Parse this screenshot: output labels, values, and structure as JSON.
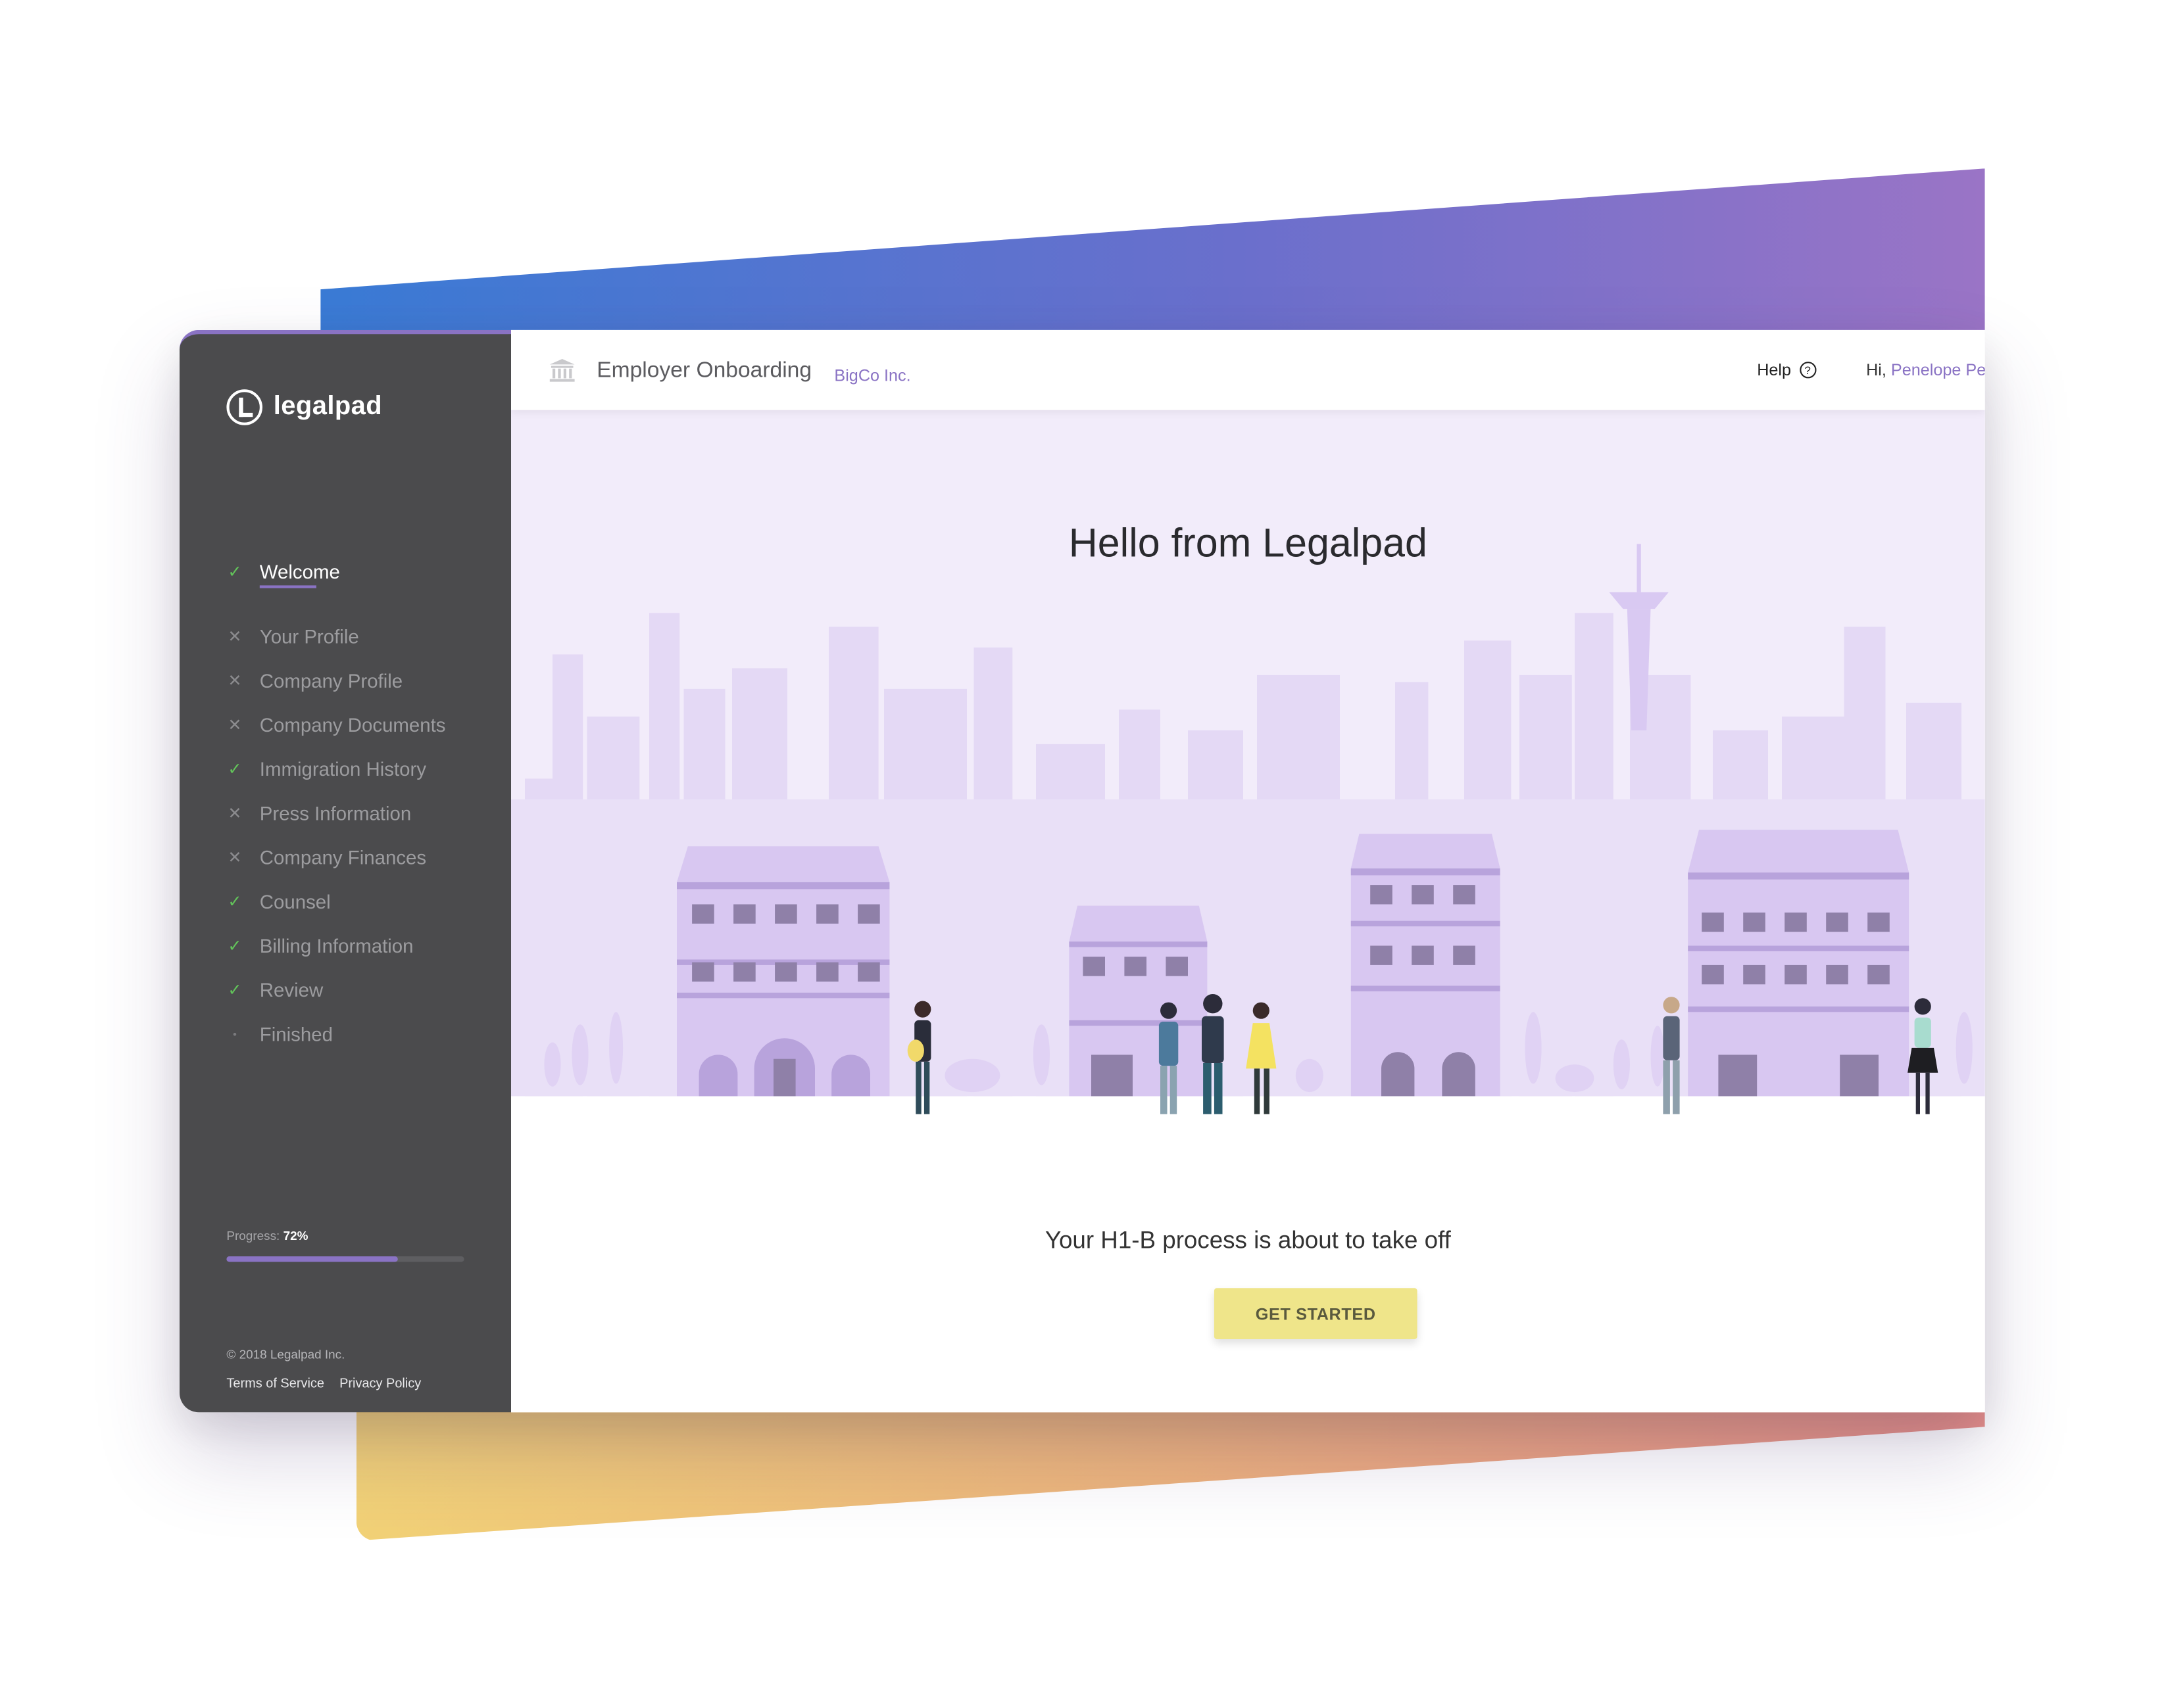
{
  "brand": {
    "name": "legalpad"
  },
  "header": {
    "title": "Employer Onboarding",
    "company": "BigCo Inc.",
    "help_label": "Help",
    "greeting_prefix": "Hi,",
    "user_name": "Penelope Pe"
  },
  "sidebar": {
    "steps": [
      {
        "label": "Welcome",
        "status": "done",
        "active": true
      },
      {
        "label": "Your Profile",
        "status": "incomplete"
      },
      {
        "label": "Company Profile",
        "status": "incomplete"
      },
      {
        "label": "Company Documents",
        "status": "incomplete"
      },
      {
        "label": "Immigration History",
        "status": "done"
      },
      {
        "label": "Press Information",
        "status": "incomplete"
      },
      {
        "label": "Company Finances",
        "status": "incomplete"
      },
      {
        "label": "Counsel",
        "status": "done"
      },
      {
        "label": "Billing Information",
        "status": "done"
      },
      {
        "label": "Review",
        "status": "done"
      },
      {
        "label": "Finished",
        "status": "pending"
      }
    ],
    "progress_label": "Progress:",
    "progress_value": "72%",
    "progress_fraction": 0.72,
    "copyright": "© 2018 Legalpad Inc.",
    "links": {
      "terms": "Terms of Service",
      "privacy": "Privacy Policy"
    }
  },
  "main": {
    "heading": "Hello from Legalpad",
    "subheading": "Your H1-B process is about to take off",
    "cta_label": "GET STARTED"
  },
  "colors": {
    "accent": "#8a73c4",
    "sidebar_bg": "#4b4b4d",
    "check": "#62c35a",
    "cta_bg": "#efe58a",
    "gradient_top": [
      "#3a7bd5",
      "#9a74c6"
    ],
    "gradient_bottom": [
      "#f2d277",
      "#e8908a"
    ]
  },
  "icons": {
    "header": "bank-icon",
    "help": "question-circle-icon",
    "done": "check-icon",
    "incomplete": "x-icon",
    "pending": "dot-icon"
  }
}
